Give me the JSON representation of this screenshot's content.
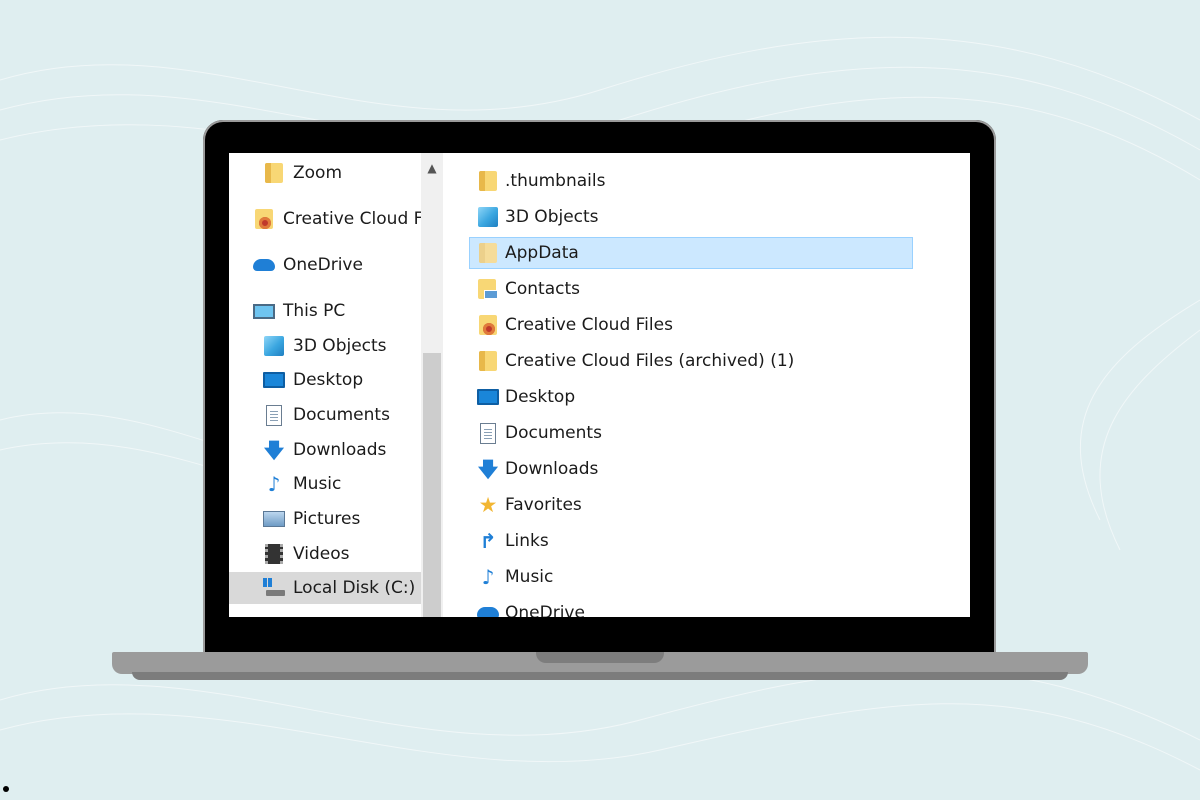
{
  "nav": {
    "items": [
      {
        "label": "Zoom",
        "icon": "folder-icon"
      },
      {
        "label": "Creative Cloud Fil",
        "icon": "creative-cloud-folder-icon"
      },
      {
        "label": "OneDrive",
        "icon": "onedrive-icon"
      },
      {
        "label": "This PC",
        "icon": "computer-icon"
      },
      {
        "label": "3D Objects",
        "icon": "3d-objects-icon"
      },
      {
        "label": "Desktop",
        "icon": "desktop-icon"
      },
      {
        "label": "Documents",
        "icon": "documents-icon"
      },
      {
        "label": "Downloads",
        "icon": "downloads-icon"
      },
      {
        "label": "Music",
        "icon": "music-icon"
      },
      {
        "label": "Pictures",
        "icon": "pictures-icon"
      },
      {
        "label": "Videos",
        "icon": "videos-icon"
      },
      {
        "label": "Local Disk (C:)",
        "icon": "local-disk-icon",
        "selected": true
      }
    ]
  },
  "content": {
    "items": [
      {
        "label": ".thumbnails",
        "icon": "folder-icon"
      },
      {
        "label": "3D Objects",
        "icon": "3d-objects-icon"
      },
      {
        "label": "AppData",
        "icon": "folder-icon",
        "selected": true
      },
      {
        "label": "Contacts",
        "icon": "contacts-icon"
      },
      {
        "label": "Creative Cloud Files",
        "icon": "creative-cloud-folder-icon"
      },
      {
        "label": "Creative Cloud Files (archived) (1)",
        "icon": "folder-icon"
      },
      {
        "label": "Desktop",
        "icon": "desktop-icon"
      },
      {
        "label": "Documents",
        "icon": "documents-icon"
      },
      {
        "label": "Downloads",
        "icon": "downloads-icon"
      },
      {
        "label": "Favorites",
        "icon": "favorites-icon"
      },
      {
        "label": "Links",
        "icon": "links-icon"
      },
      {
        "label": "Music",
        "icon": "music-icon"
      },
      {
        "label": "OneDrive",
        "icon": "onedrive-icon"
      }
    ]
  },
  "colors": {
    "background": "#dfeef0",
    "selection": "#cce8ff",
    "selection_border": "#99d1ff",
    "nav_selected": "#d9d9d9",
    "accent": "#1f7fd6"
  }
}
